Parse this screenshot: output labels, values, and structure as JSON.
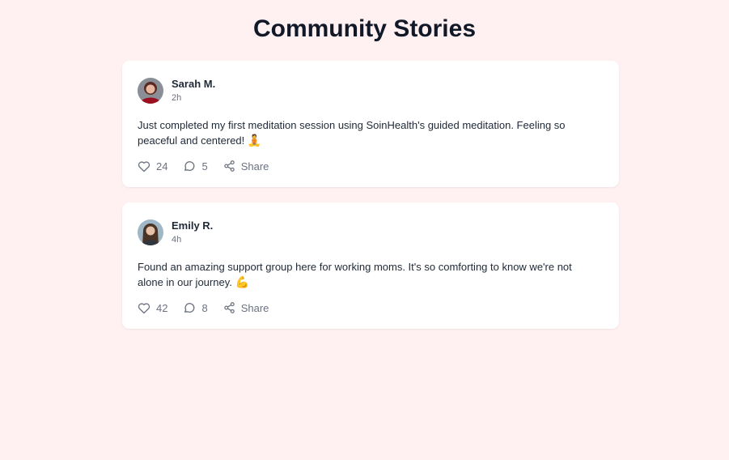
{
  "header": {
    "title": "Community Stories"
  },
  "posts": [
    {
      "author": "Sarah M.",
      "time": "2h",
      "text": "Just completed my first meditation session using SoinHealth's guided meditation. Feeling so peaceful and centered!",
      "emoji": "🧘",
      "likes": "24",
      "comments": "5",
      "share_label": "Share"
    },
    {
      "author": "Emily R.",
      "time": "4h",
      "text": "Found an amazing support group here for working moms. It's so comforting to know we're not alone in our journey.",
      "emoji": "💪",
      "likes": "42",
      "comments": "8",
      "share_label": "Share"
    }
  ],
  "icons": {
    "like": "heart-icon",
    "comment": "comment-icon",
    "share": "share-icon"
  },
  "colors": {
    "background": "#fff0f1",
    "card": "#ffffff",
    "title": "#111827",
    "muted": "#6b7280"
  }
}
